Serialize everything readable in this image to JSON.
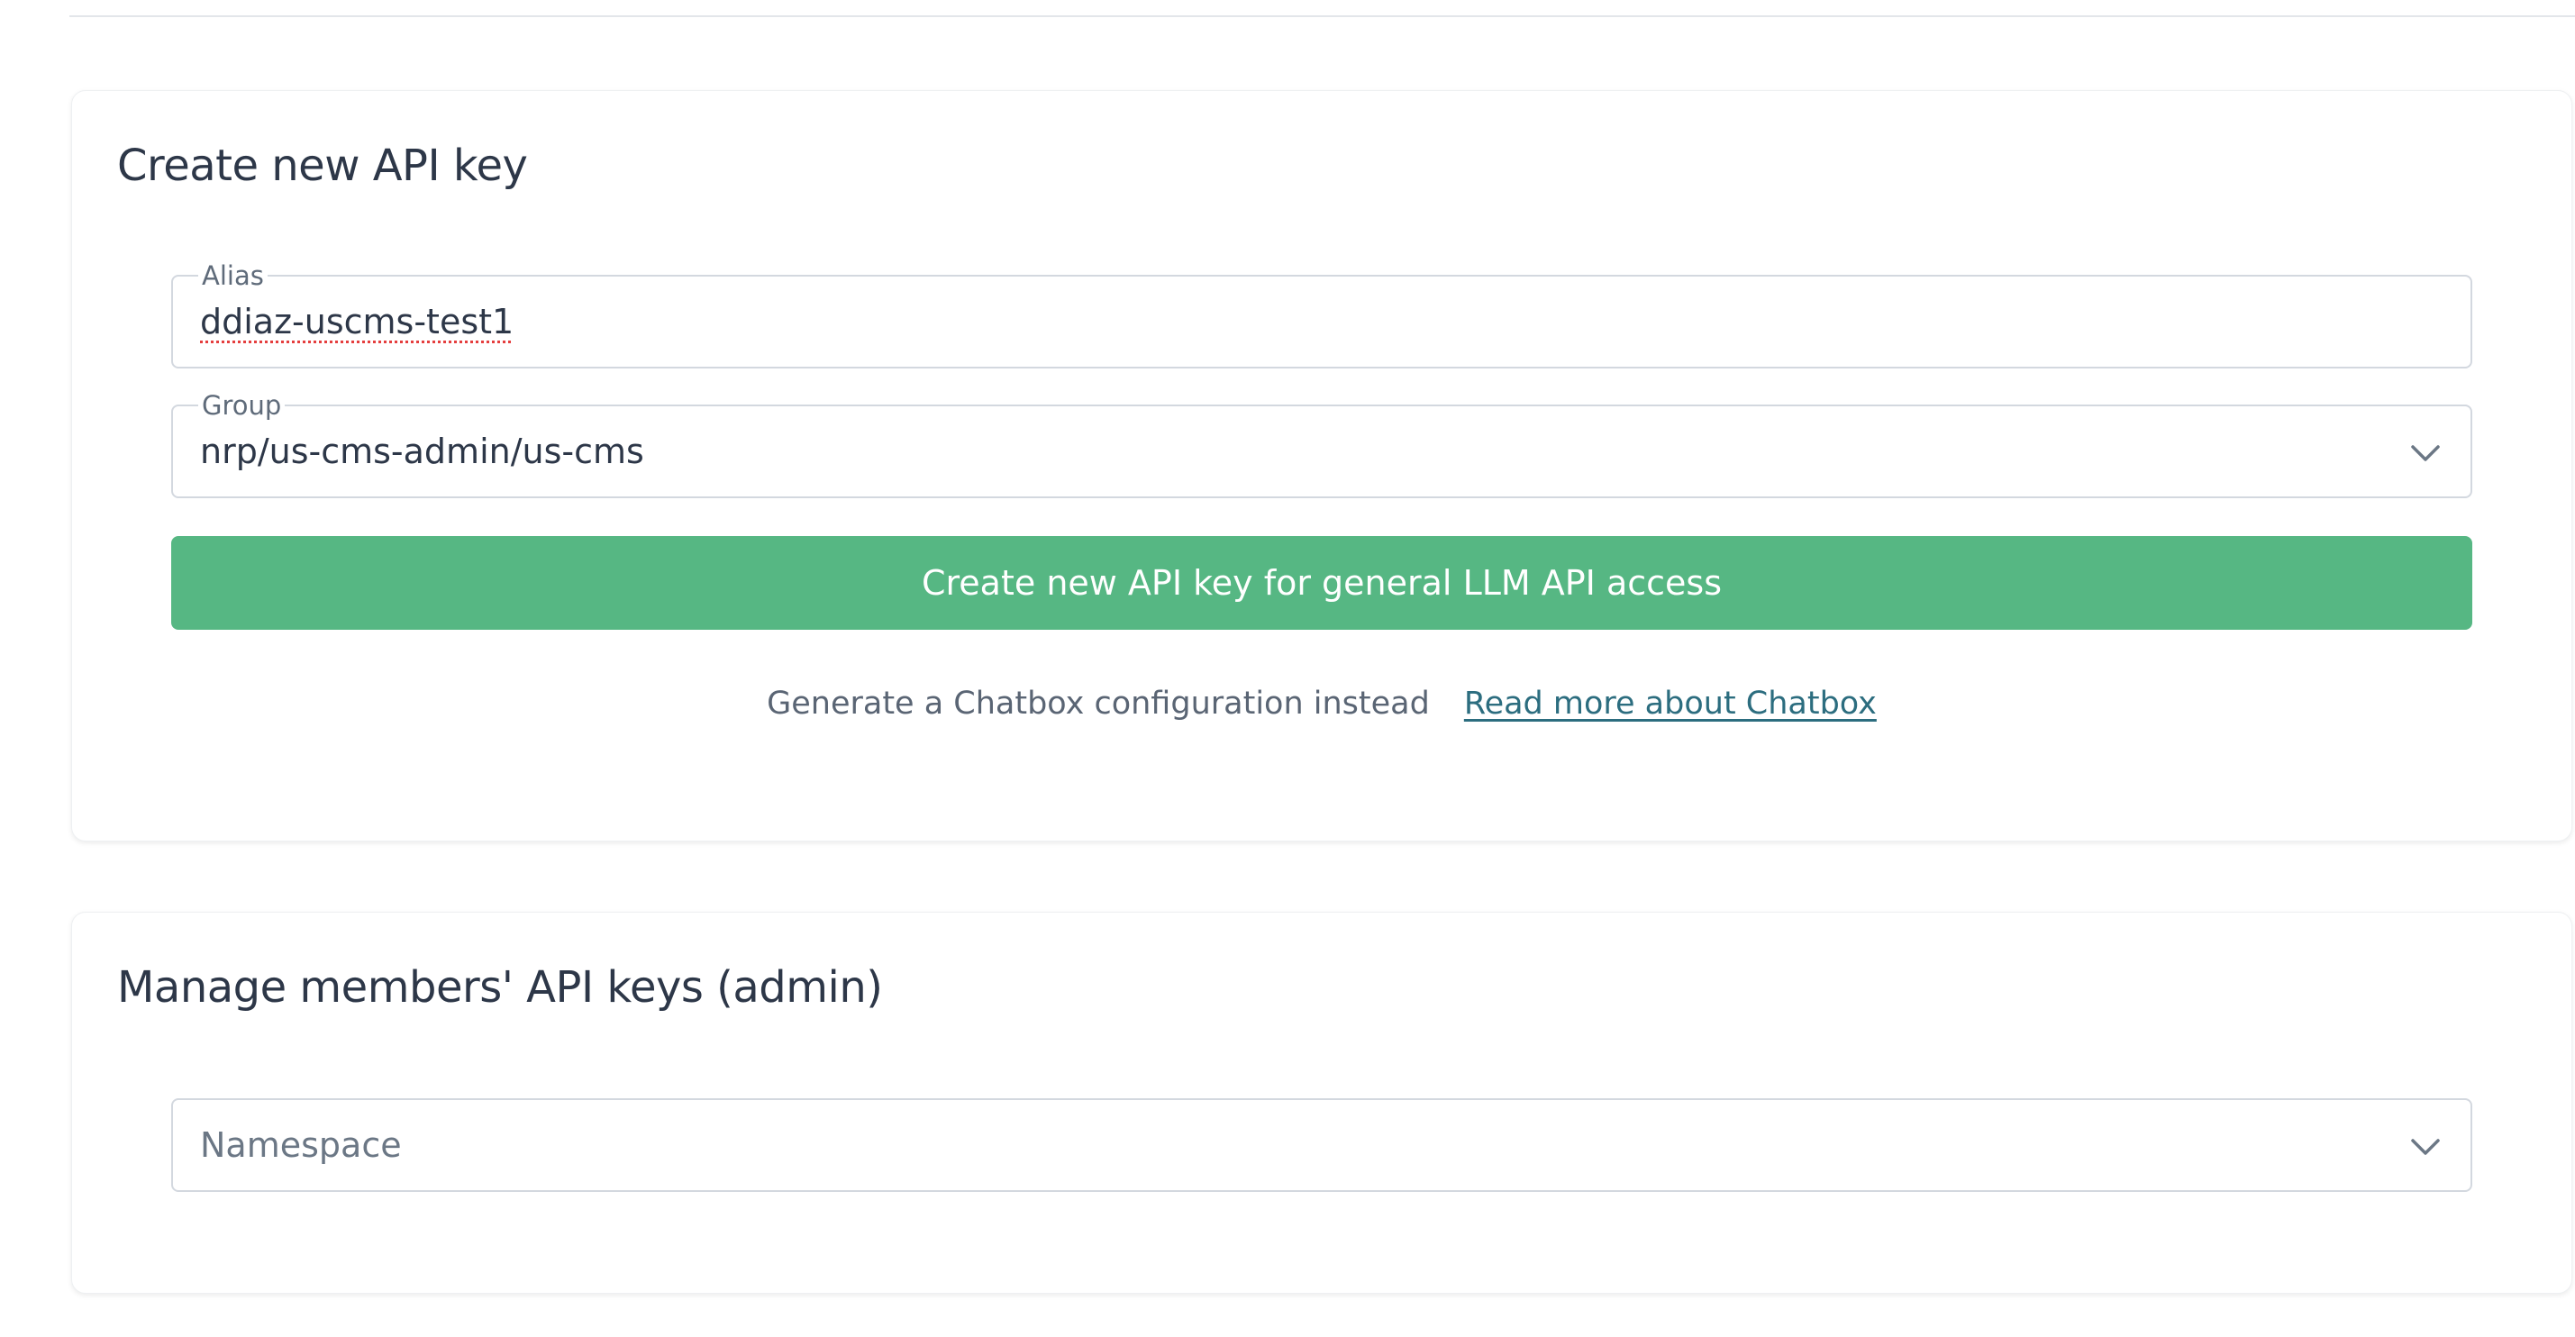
{
  "create_card": {
    "title": "Create new API key",
    "alias": {
      "label": "Alias",
      "value": "ddiaz-uscms-test1"
    },
    "group": {
      "label": "Group",
      "value": "nrp/us-cms-admin/us-cms"
    },
    "create_button_label": "Create new API key for general LLM API access",
    "chatbox_config_label": "Generate a Chatbox configuration instead",
    "read_more_label": "Read more about Chatbox"
  },
  "manage_card": {
    "title": "Manage members' API keys (admin)",
    "namespace_placeholder": "Namespace"
  },
  "colors": {
    "primary_button": "#56b783",
    "link": "#2c6d7f",
    "text": "#2d3748"
  },
  "icons": {
    "group_select": "chevron-down-icon",
    "namespace_select": "chevron-down-icon"
  }
}
